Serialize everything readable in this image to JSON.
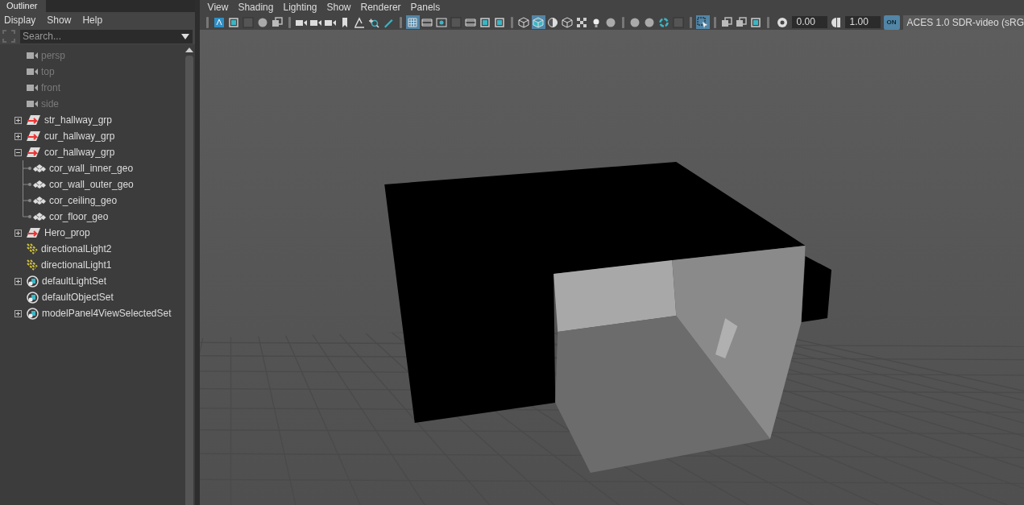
{
  "outliner": {
    "tab": "Outliner",
    "menu": [
      "Display",
      "Show",
      "Help"
    ],
    "search": {
      "placeholder": "Search..."
    },
    "items": [
      {
        "label": "persp",
        "kind": "camera",
        "hidden": true
      },
      {
        "label": "top",
        "kind": "camera",
        "hidden": true
      },
      {
        "label": "front",
        "kind": "camera",
        "hidden": true
      },
      {
        "label": "side",
        "kind": "camera",
        "hidden": true
      },
      {
        "label": "str_hallway_grp",
        "kind": "group",
        "hidden": false,
        "expanded": false
      },
      {
        "label": "cur_hallway_grp",
        "kind": "group",
        "hidden": false,
        "expanded": false
      },
      {
        "label": "cor_hallway_grp",
        "kind": "group",
        "hidden": false,
        "expanded": true,
        "children": [
          {
            "label": "cor_wall_inner_geo",
            "kind": "mesh",
            "hidden": false
          },
          {
            "label": "cor_wall_outer_geo",
            "kind": "mesh",
            "hidden": false
          },
          {
            "label": "cor_ceiling_geo",
            "kind": "mesh",
            "hidden": false
          },
          {
            "label": "cor_floor_geo",
            "kind": "mesh",
            "hidden": false
          }
        ]
      },
      {
        "label": "Hero_prop",
        "kind": "group",
        "hidden": false,
        "expanded": false
      },
      {
        "label": "directionalLight2",
        "kind": "light",
        "hidden": false
      },
      {
        "label": "directionalLight1",
        "kind": "light",
        "hidden": false
      },
      {
        "label": "defaultLightSet",
        "kind": "set",
        "hidden": false,
        "expanded": false
      },
      {
        "label": "defaultObjectSet",
        "kind": "set",
        "hidden": false
      },
      {
        "label": "modelPanel4ViewSelectedSet",
        "kind": "set",
        "hidden": false,
        "expanded": false
      }
    ]
  },
  "viewport": {
    "menu": [
      "View",
      "Shading",
      "Lighting",
      "Show",
      "Renderer",
      "Panels"
    ],
    "toolbar": [
      {
        "selected": false
      },
      {
        "selected": false
      },
      {
        "selected": false
      },
      {
        "selected": false
      },
      {
        "selected": false
      },
      {
        "selected": false
      },
      {
        "selected": false
      },
      {
        "selected": false
      },
      {
        "selected": false
      },
      {
        "selected": false
      },
      {
        "selected": false
      },
      {
        "selected": false
      },
      {
        "selected": true
      },
      {
        "selected": false
      },
      {
        "selected": false
      },
      {
        "selected": false
      },
      {
        "selected": false
      },
      {
        "selected": false
      },
      {
        "selected": false
      },
      {
        "selected": false
      },
      {
        "selected": true
      },
      {
        "selected": false
      },
      {
        "selected": false
      },
      {
        "selected": false
      },
      {
        "selected": false
      },
      {
        "selected": false
      },
      {
        "selected": false
      },
      {
        "selected": false
      },
      {
        "selected": false
      },
      {
        "selected": false
      },
      {
        "selected": true
      },
      {
        "selected": false
      },
      {
        "selected": false
      },
      {
        "selected": false
      }
    ],
    "exposure": "0.00",
    "gamma": "1.00",
    "color_management": {
      "on": true,
      "label": "ON"
    },
    "color_space": "ACES 1.0 SDR-video (sRG"
  }
}
